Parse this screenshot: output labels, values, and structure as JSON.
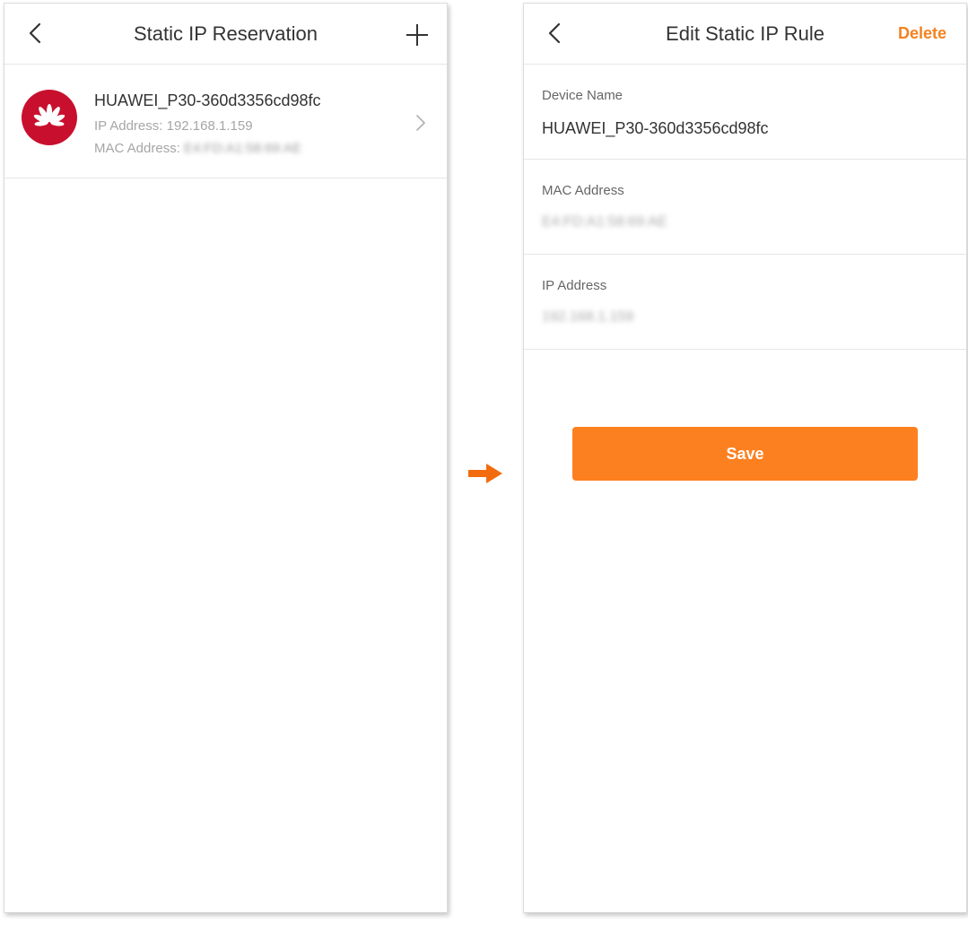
{
  "left_screen": {
    "title": "Static IP Reservation",
    "device": {
      "name": "HUAWEI_P30-360d3356cd98fc",
      "ip_label": "IP Address:",
      "ip_value": "192.168.1.159",
      "mac_label": "MAC Address:",
      "mac_value": "E4:FD:A1:58:69:AE"
    }
  },
  "right_screen": {
    "title": "Edit Static IP Rule",
    "delete_label": "Delete",
    "fields": [
      {
        "label": "Device Name",
        "value": "HUAWEI_P30-360d3356cd98fc"
      },
      {
        "label": "MAC Address",
        "value": "E4:FD:A1:58:69:AE"
      },
      {
        "label": "IP Address",
        "value": "192.168.1.159"
      }
    ],
    "save_label": "Save"
  },
  "icons": {
    "back": "chevron-left-icon",
    "add": "plus-icon",
    "row_chevron": "chevron-right-icon",
    "avatar": "huawei-logo-icon",
    "flow": "arrow-right-icon"
  },
  "colors": {
    "accent": "#fd8020",
    "delete": "#f5811f",
    "huawei_red": "#c8102e",
    "flow_arrow": "#f26b0f"
  }
}
